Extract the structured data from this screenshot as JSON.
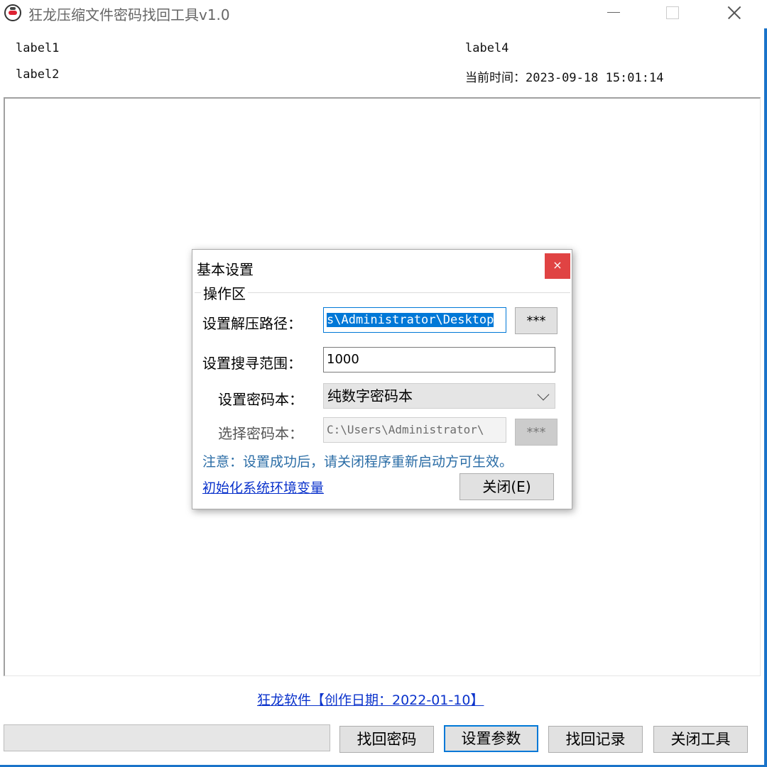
{
  "window": {
    "title": "狂龙压缩文件密码找回工具v1.0",
    "app_icon": "dragon-logo-icon",
    "controls": {
      "minimize": "minimize-icon",
      "maximize": "maximize-icon",
      "close": "close-icon"
    }
  },
  "header": {
    "label1": "label1",
    "label2": "label2",
    "label4": "label4",
    "time_label": "当前时间：2023-09-18 15:01:14"
  },
  "footer": {
    "link": "狂龙软件【创作日期：2022-01-10】",
    "progress_value": 0,
    "buttons": {
      "find_password": "找回密码",
      "set_params": "设置参数",
      "history": "找回记录",
      "close_tool": "关闭工具"
    }
  },
  "dialog": {
    "title": "基本设置",
    "close_glyph": "×",
    "group_title": "操作区",
    "extract_path": {
      "label": "设置解压路径：",
      "value": "s\\Administrator\\Desktop",
      "browse": "***"
    },
    "search_range": {
      "label": "设置搜寻范围：",
      "value": "1000"
    },
    "dictionary": {
      "label": "设置密码本：",
      "selected": "纯数字密码本"
    },
    "choose_dict": {
      "label": "选择密码本：",
      "value": "C:\\Users\\Administrator\\",
      "browse": "***"
    },
    "note": "注意：设置成功后，请关闭程序重新启动方可生效。",
    "init_link": "初始化系统环境变量",
    "close_button": "关闭(E)"
  },
  "colors": {
    "accent": "#0078d7",
    "link": "#0b33cc",
    "close_red": "#e04343",
    "note": "#2b6da6"
  }
}
